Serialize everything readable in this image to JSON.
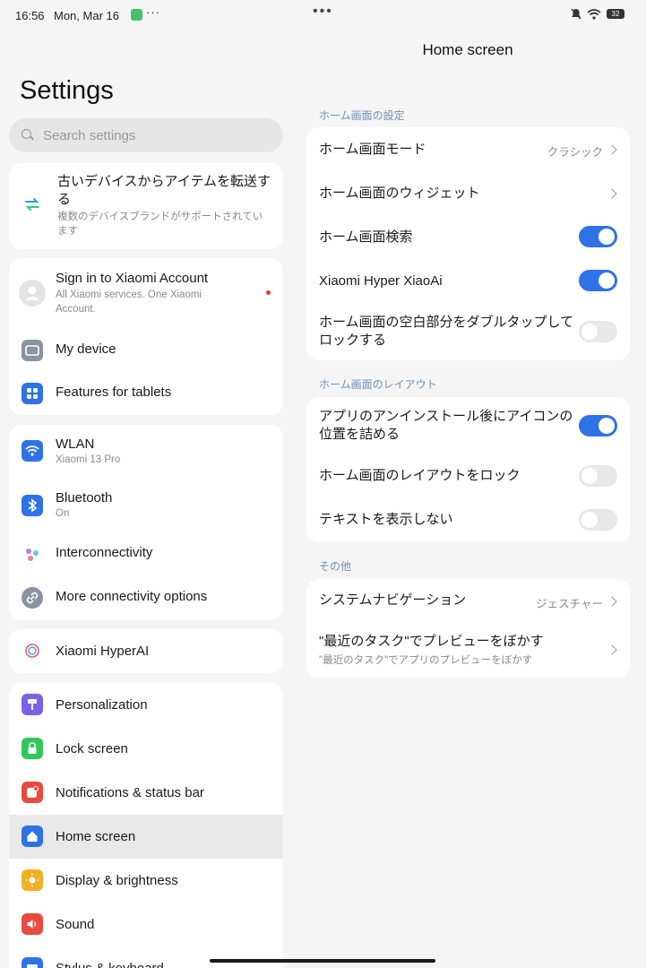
{
  "status_bar": {
    "time": "16:56",
    "date": "Mon, Mar 16",
    "more": "···",
    "center_dots": "•••",
    "battery": "32"
  },
  "left": {
    "title": "Settings",
    "search_placeholder": "Search settings",
    "transfer": {
      "title": "古いデバイスからアイテムを転送する",
      "subtitle": "複数のデバイスブランドがサポートされています"
    },
    "account": {
      "label": "Sign in to Xiaomi Account",
      "subtitle": "All Xiaomi services. One Xiaomi Account."
    },
    "my_device": "My device",
    "features_tablets": "Features for tablets",
    "wlan": {
      "label": "WLAN",
      "subtitle": "Xiaomi 13 Pro"
    },
    "bluetooth": {
      "label": "Bluetooth",
      "subtitle": "On"
    },
    "interconnectivity": "Interconnectivity",
    "more_connectivity": "More connectivity options",
    "hyperai": "Xiaomi HyperAI",
    "personalization": "Personalization",
    "lock_screen": "Lock screen",
    "notifications": "Notifications & status bar",
    "home_screen": "Home screen",
    "display": "Display & brightness",
    "sound": "Sound",
    "stylus": "Stylus & keyboard"
  },
  "right": {
    "title": "Home screen",
    "section1": "ホーム画面の設定",
    "home_mode": {
      "label": "ホーム画面モード",
      "value": "クラシック"
    },
    "widgets": "ホーム画面のウィジェット",
    "search": {
      "label": "ホーム画面検索",
      "on": true
    },
    "xiaoai": {
      "label": "Xiaomi Hyper XiaoAi",
      "on": true
    },
    "double_tap": {
      "label": "ホーム画面の空白部分をダブルタップしてロックする",
      "on": false
    },
    "section2": "ホーム画面のレイアウト",
    "fill_icons": {
      "label": "アプリのアンインストール後にアイコンの位置を詰める",
      "on": true
    },
    "lock_layout": {
      "label": "ホーム画面のレイアウトをロック",
      "on": false
    },
    "hide_text": {
      "label": "テキストを表示しない",
      "on": false
    },
    "section3": "その他",
    "system_nav": {
      "label": "システムナビゲーション",
      "value": "ジェスチャー"
    },
    "blur": {
      "label": "\"最近のタスク\"でプレビューをぼかす",
      "subtitle": "\"最近のタスク\"でアプリのプレビューをぼかす"
    }
  },
  "colors": {
    "accent": "#2f72e6",
    "section_label": "#6f8fb5",
    "background": "#f5f5f5"
  }
}
